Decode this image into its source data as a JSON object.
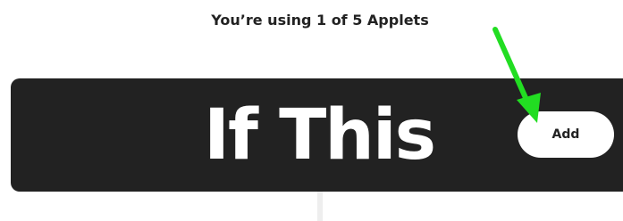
{
  "header": {
    "usage_text": "You’re using 1 of 5 Applets"
  },
  "trigger": {
    "title": "If This",
    "add_label": "Add"
  },
  "colors": {
    "card_background": "#222222",
    "arrow": "#22dd22",
    "connector": "#eeeeee"
  }
}
